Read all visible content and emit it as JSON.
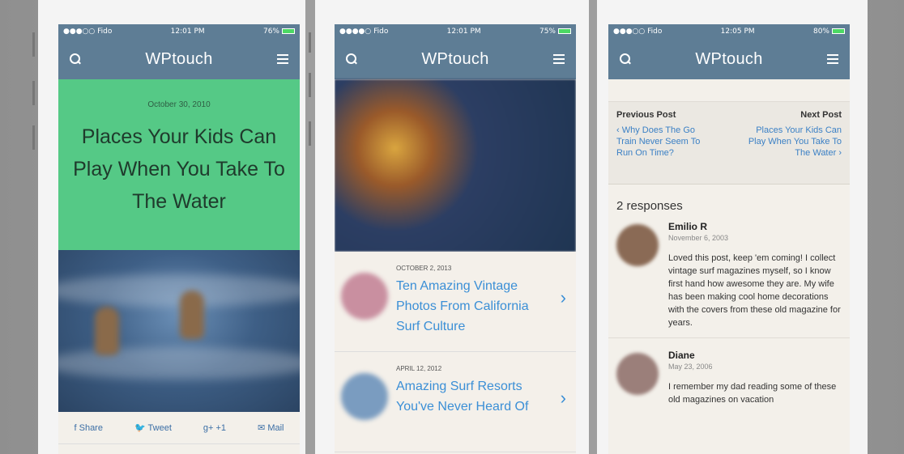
{
  "screens": [
    {
      "status": {
        "carrier": "●●●○○ Fido",
        "time": "12:01 PM",
        "battery": "76%"
      },
      "nav": {
        "title": "WPtouch"
      },
      "post": {
        "date": "October 30, 2010",
        "title": "Places Your Kids Can Play When You Take To The Water"
      },
      "share": {
        "share": "f Share",
        "tweet": "Tweet",
        "gplus": "g+ +1",
        "mail": "Mail"
      }
    },
    {
      "status": {
        "carrier": "●●●●○ Fido",
        "time": "12:01 PM",
        "battery": "75%"
      },
      "nav": {
        "title": "WPtouch"
      },
      "posts": [
        {
          "date": "OCTOBER 2, 2013",
          "title": "Ten Amazing Vintage Photos From California Surf Culture",
          "thumb_color": "#c98fa0"
        },
        {
          "date": "APRIL 12, 2012",
          "title": "Amazing Surf Resorts You've Never Heard Of",
          "thumb_color": "#7a9cc0"
        }
      ]
    },
    {
      "status": {
        "carrier": "●●●○○ Fido",
        "time": "12:05 PM",
        "battery": "80%"
      },
      "nav": {
        "title": "WPtouch"
      },
      "prevnext": {
        "prev_label": "Previous Post",
        "next_label": "Next Post",
        "prev_title": "‹ Why Does The Go Train Never Seem To Run On Time?",
        "next_title": "Places Your Kids Can Play When You Take To The Water ›"
      },
      "responses": "2 responses",
      "comments": [
        {
          "name": "Emilio R",
          "date": "November 6, 2003",
          "text": "Loved this post, keep 'em coming! I collect vintage surf magazines myself, so I know first hand how awesome they are. My wife has been making cool home decorations with the covers from these old magazine for years.",
          "avatar_color": "#8a6a55"
        },
        {
          "name": "Diane",
          "date": "May 23, 2006",
          "text": "I remember my dad reading some of these old magazines on vacation",
          "avatar_color": "#9b7f7a"
        }
      ]
    }
  ],
  "colors": {
    "accent": "#5e7d95",
    "hero": "#55c986",
    "link": "#3b8fd6"
  }
}
